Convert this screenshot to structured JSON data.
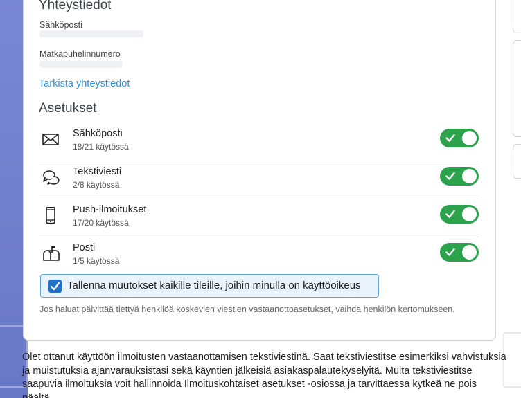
{
  "contact": {
    "title": "Yhteystiedot",
    "email_label": "Sähköposti",
    "phone_label": "Matkapuhelinnumero",
    "check_link": "Tarkista yhteystiedot"
  },
  "settings": {
    "title": "Asetukset",
    "items": [
      {
        "name": "Sähköposti",
        "count": "18/21 käytössä",
        "icon": "envelope-icon",
        "enabled": true
      },
      {
        "name": "Tekstiviesti",
        "count": "2/8 käytössä",
        "icon": "speech-bubbles-icon",
        "enabled": true
      },
      {
        "name": "Push-ilmoitukset",
        "count": "17/20 käytössä",
        "icon": "mobile-phone-icon",
        "enabled": true
      },
      {
        "name": "Posti",
        "count": "1/5 käytössä",
        "icon": "mailbox-icon",
        "enabled": true
      }
    ],
    "save_all_label": "Tallenna muutokset kaikille tileille, joihin minulla on käyttöoikeus",
    "save_all_checked": true,
    "note": "Jos haluat päivittää tiettyä henkilöä koskevien viestien vastaanottoasetukset, vaihda henkilön kertomukseen."
  },
  "info_text": "Olet ottanut käyttöön ilmoitusten vastaanottamisen tekstiviestinä. Saat tekstiviestitse esimerkiksi vahvistuksia ja muistutuksia ajanvarauksistasi sekä käyntien jälkeisiä asiakaspalautekyselyitä. Muita tekstiviestitse saapuvia ilmoituksia voit hallinnoida Ilmoituskohtaiset asetukset -osiossa ja tarvittaessa kytkeä ne pois päältä.",
  "colors": {
    "toggle_on": "#2ca24c",
    "link": "#2f8fd8",
    "checkbox": "#2272c9",
    "sidebar": "#7a87d4"
  }
}
